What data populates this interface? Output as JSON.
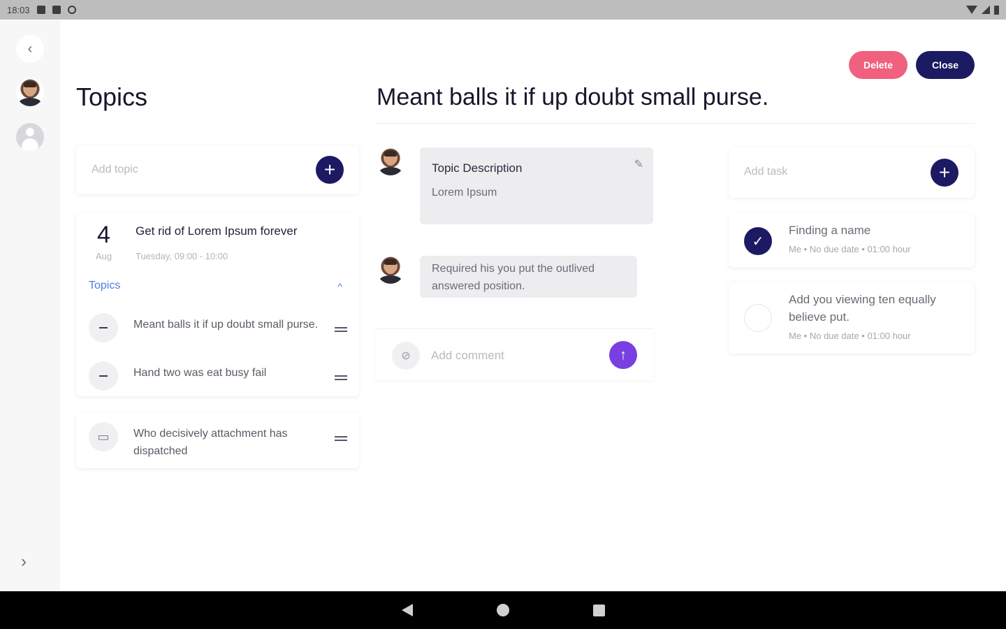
{
  "status_bar": {
    "time": "18:03"
  },
  "rail": {
    "back_icon": "‹",
    "forward_icon": "›"
  },
  "topics_panel": {
    "title": "Topics",
    "add_topic_placeholder": "Add topic",
    "add_icon": "+",
    "meeting": {
      "day": "4",
      "month": "Aug",
      "title": "Get rid of Lorem Ipsum forever",
      "time": "Tuesday, 09:00 - 10:00",
      "topics_label": "Topics",
      "collapse_icon": "^",
      "items": [
        {
          "text": "Meant balls it if up doubt small purse."
        },
        {
          "text": "Hand two was eat busy fail"
        }
      ]
    },
    "note": {
      "text": "Who decisively attachment has dispatched"
    }
  },
  "header": {
    "title": "Meant balls it if up doubt small purse.",
    "delete_label": "Delete",
    "close_label": "Close"
  },
  "conversation": {
    "description_title": "Topic Description",
    "description_body": "Lorem Ipsum",
    "comment": "Required his you put the outlived answered position.",
    "comment_placeholder": "Add comment",
    "attach_icon": "⊘",
    "send_icon": "↑",
    "edit_icon": "✎"
  },
  "tasks": {
    "add_task_placeholder": "Add task",
    "items": [
      {
        "title": "Finding a name",
        "meta": "Me • No due date • 01:00 hour",
        "done": true
      },
      {
        "title": "Add you viewing ten equally believe put.",
        "meta": "Me • No due date • 01:00 hour",
        "done": false
      }
    ],
    "check_icon": "✓"
  },
  "colors": {
    "primary": "#1c1a63",
    "danger": "#f0607f",
    "send": "#7a3fe0",
    "link": "#4a7de6"
  }
}
